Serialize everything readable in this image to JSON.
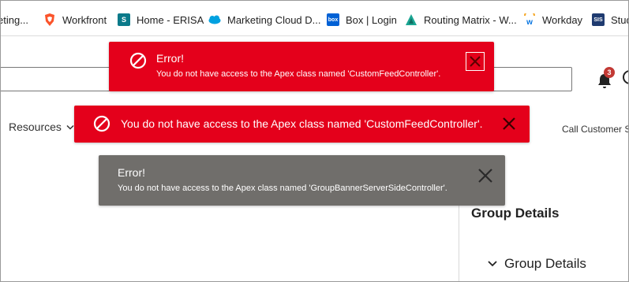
{
  "bookmarks": [
    {
      "label": "eting...",
      "icon": "none"
    },
    {
      "label": "Workfront",
      "icon": "brave-lion-icon",
      "color": "#fb542b"
    },
    {
      "label": "Home - ERISA",
      "icon": "sharepoint-icon",
      "color": "#0b7a8a"
    },
    {
      "label": "Marketing Cloud D...",
      "icon": "salesforce-cloud-icon",
      "color": "#00a1e0"
    },
    {
      "label": "Box | Login",
      "icon": "box-icon",
      "color": "#0061d5",
      "badge": "box"
    },
    {
      "label": "Routing Matrix - W...",
      "icon": "triangle-app-icon",
      "color": "#1aa592"
    },
    {
      "label": "Workday",
      "icon": "workday-icon",
      "color": "#f5a623"
    },
    {
      "label": "Stud",
      "icon": "sis-icon",
      "color": "#1f3b70",
      "badge": "SIS"
    }
  ],
  "header": {
    "notification_count": "3"
  },
  "nav": {
    "resources_label": "Resources",
    "call_label": "Call Customer S"
  },
  "sidebar": {
    "title": "Group Details",
    "section_label": "Group Details"
  },
  "toasts": [
    {
      "title": "Error!",
      "message": "You do not have access to the Apex class named 'CustomFeedController'.",
      "variant": "error",
      "color": "#e4001b"
    },
    {
      "title": "",
      "message": "You do not have access to the Apex class named 'CustomFeedController'.",
      "variant": "error",
      "color": "#e4001b"
    },
    {
      "title": "Error!",
      "message": "You do not have access to the Apex class named 'GroupBannerServerSideController'.",
      "variant": "info",
      "color": "#706e6b"
    }
  ]
}
